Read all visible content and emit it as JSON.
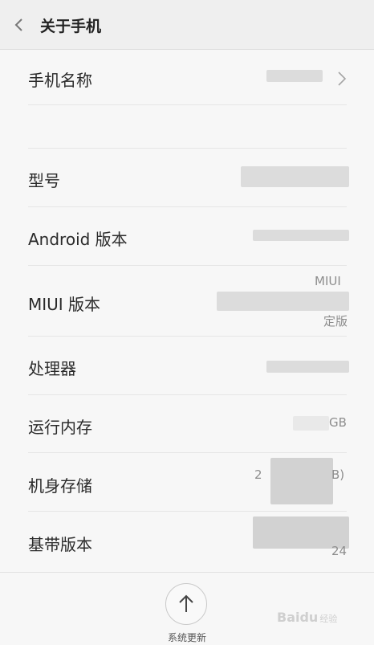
{
  "header": {
    "title": "关于手机",
    "back_icon": "chevron-left-icon"
  },
  "rows": [
    {
      "label": "手机名称",
      "value": "",
      "icon": "chevron-right-icon"
    },
    {
      "label": "",
      "value": ""
    },
    {
      "label": "型号",
      "value": ""
    },
    {
      "label": "Android 版本",
      "value": ""
    },
    {
      "label": "MIUI 版本",
      "value_top": "MIUI",
      "value_bottom": "定版"
    },
    {
      "label": "处理器",
      "value": ""
    },
    {
      "label": "运行内存",
      "value": "GB"
    },
    {
      "label": "机身存储",
      "value_left": "2",
      "value_right": "B)"
    },
    {
      "label": "基带版本",
      "value_bottom": "24"
    }
  ],
  "footer": {
    "update_label": "系统更新",
    "update_icon": "arrow-up-icon"
  },
  "watermark": {
    "text": "Baidu",
    "sub": "经验"
  }
}
